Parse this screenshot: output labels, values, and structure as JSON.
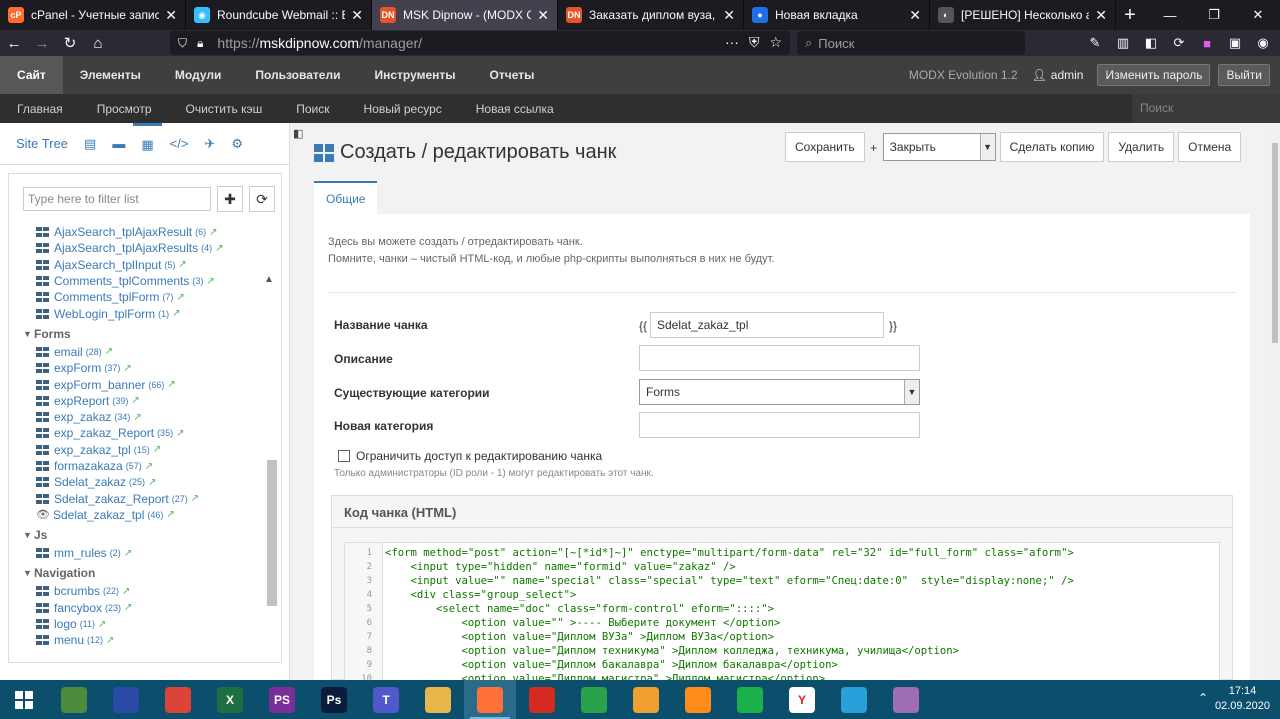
{
  "browser": {
    "tabs": [
      {
        "title": "cPanel - Учетные записи",
        "fav": "cP",
        "color": "#ff6c2c",
        "active": false
      },
      {
        "title": "Roundcube Webmail :: Вход",
        "fav": "◉",
        "color": "#37beff",
        "active": false
      },
      {
        "title": "MSK Dipnow - (MODX CMS)",
        "fav": "DN",
        "color": "#e8542a",
        "active": true
      },
      {
        "title": "Заказать диплом вуза, колледжа",
        "fav": "DN",
        "color": "#e8542a",
        "active": false
      },
      {
        "title": "Новая вкладка",
        "fav": "●",
        "color": "#1f6feb",
        "active": false
      },
      {
        "title": "[РЕШЕНО] Несколько аяксов",
        "fav": "◐",
        "color": "#555555",
        "active": false
      }
    ],
    "new_tab": "+",
    "url_scheme": "https://",
    "url_host": "mskdipnow.com",
    "url_path": "/manager/",
    "search_placeholder": "Поиск",
    "back": "←",
    "forward": "→",
    "reload": "↻",
    "home": "⌂"
  },
  "header": {
    "nav": [
      "Сайт",
      "Элементы",
      "Модули",
      "Пользователи",
      "Инструменты",
      "Отчеты"
    ],
    "active_nav": "Сайт",
    "version": "MODX Evolution 1.2",
    "username": "admin",
    "change_password": "Изменить пароль",
    "logout": "Выйти"
  },
  "subnav": {
    "items": [
      "Главная",
      "Просмотр",
      "Очистить кэш",
      "Поиск",
      "Новый ресурс",
      "Новая ссылка"
    ],
    "search_placeholder": "Поиск"
  },
  "tree": {
    "site_tree_label": "Site Tree",
    "filter_placeholder": "Type here to filter list",
    "groups": [
      {
        "name": "",
        "items": [
          {
            "name": "AjaxSearch_tplAjaxResult",
            "count": "(6)"
          },
          {
            "name": "AjaxSearch_tplAjaxResults",
            "count": "(4)"
          },
          {
            "name": "AjaxSearch_tplInput",
            "count": "(5)"
          },
          {
            "name": "Comments_tplComments",
            "count": "(3)"
          },
          {
            "name": "Comments_tplForm",
            "count": "(7)"
          },
          {
            "name": "WebLogin_tplForm",
            "count": "(1)"
          }
        ]
      },
      {
        "name": "Forms",
        "items": [
          {
            "name": "email",
            "count": "(28)"
          },
          {
            "name": "expForm",
            "count": "(37)"
          },
          {
            "name": "expForm_banner",
            "count": "(66)"
          },
          {
            "name": "expReport",
            "count": "(39)"
          },
          {
            "name": "exp_zakaz",
            "count": "(34)"
          },
          {
            "name": "exp_zakaz_Report",
            "count": "(35)"
          },
          {
            "name": "exp_zakaz_tpl",
            "count": "(15)"
          },
          {
            "name": "formazakaza",
            "count": "(57)"
          },
          {
            "name": "Sdelat_zakaz",
            "count": "(25)"
          },
          {
            "name": "Sdelat_zakaz_Report",
            "count": "(27)"
          },
          {
            "name": "Sdelat_zakaz_tpl",
            "count": "(46)",
            "current": true
          }
        ]
      },
      {
        "name": "Js",
        "items": [
          {
            "name": "mm_rules",
            "count": "(2)"
          }
        ]
      },
      {
        "name": "Navigation",
        "items": [
          {
            "name": "bcrumbs",
            "count": "(22)"
          },
          {
            "name": "fancybox",
            "count": "(23)"
          },
          {
            "name": "logo",
            "count": "(11)"
          },
          {
            "name": "menu",
            "count": "(12)"
          }
        ]
      }
    ]
  },
  "page": {
    "title": "Создать / редактировать чанк",
    "buttons": {
      "save": "Сохранить",
      "plus": "+",
      "close_select": "Закрыть",
      "copy": "Сделать копию",
      "delete": "Удалить",
      "cancel": "Отмена"
    },
    "tab_general": "Общие",
    "desc_line1": "Здесь вы можете создать / отредактировать чанк.",
    "desc_line2": "Помните, чанки – чистый HTML-код, и любые php-скрипты выполняться в них не будут.",
    "fields": {
      "name_label": "Название чанка",
      "name_value": "Sdelat_zakaz_tpl",
      "brace_open": "{{",
      "brace_close": "}}",
      "desc_label": "Описание",
      "desc_value": "",
      "category_label": "Существующие категории",
      "category_value": "Forms",
      "new_category_label": "Новая категория",
      "new_category_value": "",
      "lock_label": "Ограничить доступ к редактированию чанка",
      "lock_note": "Только администраторы (ID роли - 1) могут редактировать этот чанк."
    },
    "code_title": "Код чанка (HTML)",
    "code_lines": [
      "<form method=\"post\" action=\"[~[*id*]~]\" enctype=\"multipart/form-data\" rel=\"32\" id=\"full_form\" class=\"aform\">",
      "    <input type=\"hidden\" name=\"formid\" value=\"zakaz\" />",
      "    <input value=\"\" name=\"special\" class=\"special\" type=\"text\" eform=\"Спец:date:0\"  style=\"display:none;\" />",
      "    <div class=\"group_select\">",
      "        <select name=\"doc\" class=\"form-control\" eform=\"::::\">",
      "            <option value=\"\" >---- Выберите документ </option>",
      "            <option value=\"Диплом ВУЗа\" >Диплом ВУЗа</option>",
      "            <option value=\"Диплом техникума\" >Диплом колледжа, техникума, училища</option>",
      "            <option value=\"Диплом бакалавра\" >Диплом бакалавра</option>",
      "            <option value=\"Диплом магистра\" >Диплом магистра</option>"
    ]
  },
  "taskbar": {
    "apps": [
      {
        "name": "sheets-app",
        "label": "",
        "color": "#4c8a3c"
      },
      {
        "name": "save-app",
        "label": "",
        "color": "#2b4aa8"
      },
      {
        "name": "chrome-app",
        "label": "",
        "color": "#db4437"
      },
      {
        "name": "excel-app",
        "label": "X",
        "color": "#1d6f42"
      },
      {
        "name": "phpstorm-app",
        "label": "PS",
        "color": "#7b2e9a"
      },
      {
        "name": "photoshop-app",
        "label": "Ps",
        "color": "#0b1d3a"
      },
      {
        "name": "teams-app",
        "label": "T",
        "color": "#5059c9"
      },
      {
        "name": "explorer-app",
        "label": "",
        "color": "#e8b64a"
      },
      {
        "name": "firefox-app",
        "label": "",
        "color": "#ff7139",
        "active": true
      },
      {
        "name": "acrobat-app",
        "label": "",
        "color": "#d42a1f"
      },
      {
        "name": "store-app",
        "label": "",
        "color": "#2aa24b"
      },
      {
        "name": "outlook-app",
        "label": "",
        "color": "#f0a030"
      },
      {
        "name": "sublime-app",
        "label": "",
        "color": "#ff8c1a"
      },
      {
        "name": "evernote-app",
        "label": "",
        "color": "#1bb14a"
      },
      {
        "name": "yandex-app",
        "label": "Y",
        "color": "#ffffff"
      },
      {
        "name": "telegram-app",
        "label": "",
        "color": "#2aa0da"
      },
      {
        "name": "paint-app",
        "label": "",
        "color": "#9f6db3"
      }
    ],
    "time": "17:14",
    "date": "02.09.2020"
  }
}
